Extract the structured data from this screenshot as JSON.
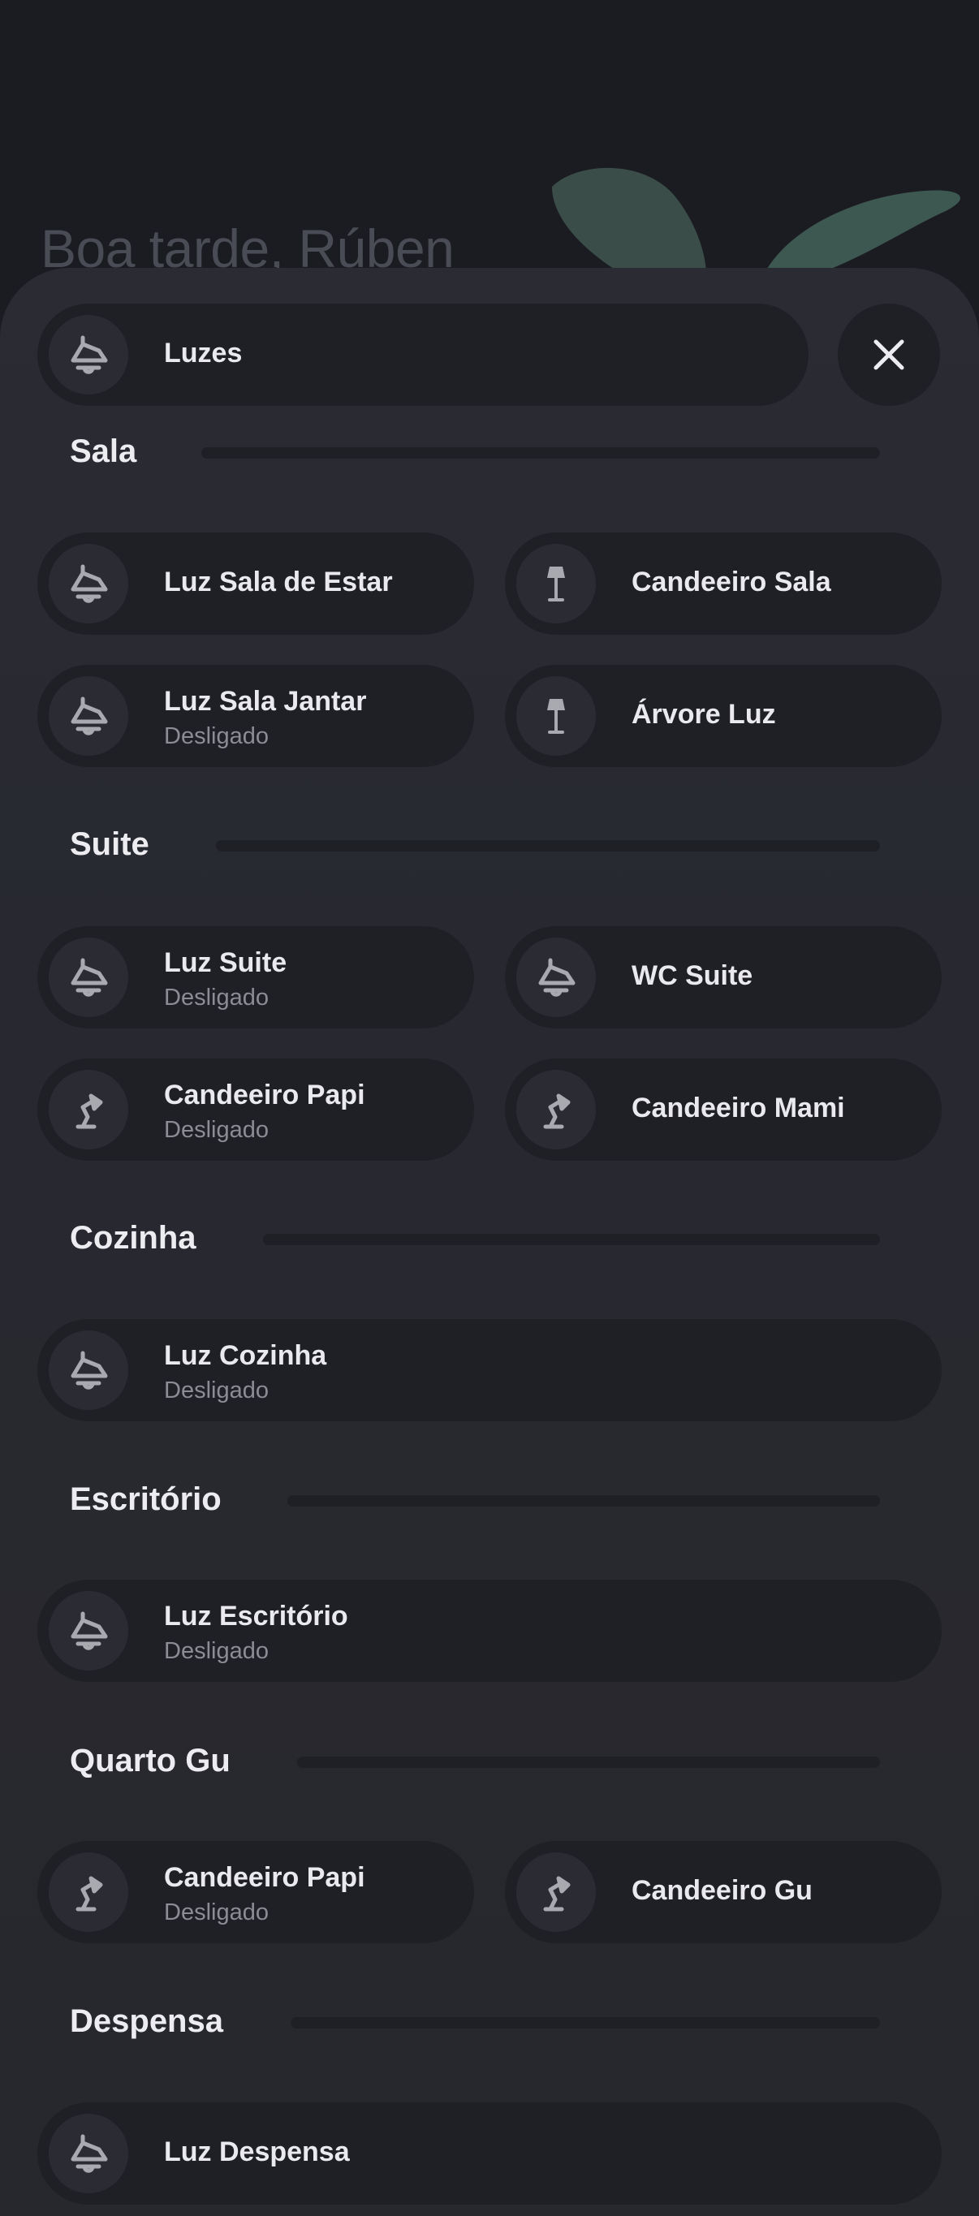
{
  "background": {
    "greeting": "Boa tarde, Rúben"
  },
  "header": {
    "title": "Luzes",
    "close_label": "close"
  },
  "sections": [
    {
      "title": "Sala",
      "items": [
        {
          "name": "Luz Sala de Estar",
          "status": "",
          "icon": "ceiling-light-icon"
        },
        {
          "name": "Candeeiro Sala",
          "status": "",
          "icon": "floor-lamp-icon"
        },
        {
          "name": "Luz Sala Jantar",
          "status": "Desligado",
          "icon": "ceiling-light-icon"
        },
        {
          "name": "Árvore Luz",
          "status": "",
          "icon": "floor-lamp-icon"
        }
      ]
    },
    {
      "title": "Suite",
      "items": [
        {
          "name": "Luz Suite",
          "status": "Desligado",
          "icon": "ceiling-light-icon"
        },
        {
          "name": "WC Suite",
          "status": "",
          "icon": "ceiling-light-icon"
        },
        {
          "name": "Candeeiro Papi",
          "status": "Desligado",
          "icon": "desk-lamp-icon"
        },
        {
          "name": "Candeeiro Mami",
          "status": "",
          "icon": "desk-lamp-icon"
        }
      ]
    },
    {
      "title": "Cozinha",
      "items": [
        {
          "name": "Luz Cozinha",
          "status": "Desligado",
          "icon": "ceiling-light-icon"
        }
      ]
    },
    {
      "title": "Escritório",
      "items": [
        {
          "name": "Luz Escritório",
          "status": "Desligado",
          "icon": "ceiling-light-icon"
        }
      ]
    },
    {
      "title": "Quarto Gu",
      "items": [
        {
          "name": "Candeeiro Papi",
          "status": "Desligado",
          "icon": "desk-lamp-icon"
        },
        {
          "name": "Candeeiro Gu",
          "status": "",
          "icon": "desk-lamp-icon"
        }
      ]
    },
    {
      "title": "Despensa",
      "items": [
        {
          "name": "Luz Despensa",
          "status": "",
          "icon": "ceiling-light-icon"
        }
      ]
    }
  ],
  "colors": {
    "page_bg": "#1b1c21",
    "sheet_bg": "#2a2b33",
    "pill_bg": "#1f2025",
    "icon_bg": "#2b2c33",
    "icon_fg": "#a9aab0",
    "text_primary": "#e9e9ee",
    "text_secondary": "#8c8d94"
  }
}
